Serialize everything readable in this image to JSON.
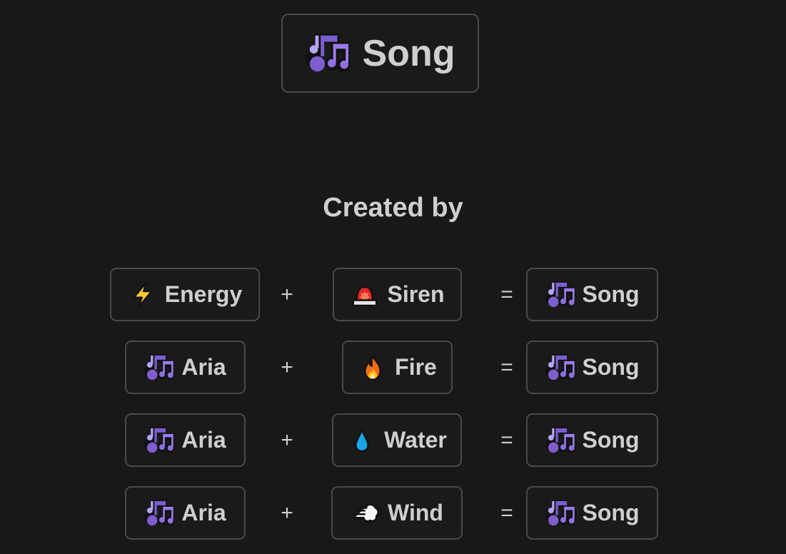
{
  "element": {
    "name": "Song",
    "icon": "musical-notes-icon"
  },
  "section_heading": "Created by",
  "recipes": [
    {
      "first": {
        "name": "Energy",
        "icon": "lightning-icon"
      },
      "plus": "+",
      "second": {
        "name": "Siren",
        "icon": "siren-light-icon"
      },
      "equals": "=",
      "result": {
        "name": "Song",
        "icon": "musical-notes-icon"
      }
    },
    {
      "first": {
        "name": "Aria",
        "icon": "musical-notes-icon"
      },
      "plus": "+",
      "second": {
        "name": "Fire",
        "icon": "fire-icon"
      },
      "equals": "=",
      "result": {
        "name": "Song",
        "icon": "musical-notes-icon"
      }
    },
    {
      "first": {
        "name": "Aria",
        "icon": "musical-notes-icon"
      },
      "plus": "+",
      "second": {
        "name": "Water",
        "icon": "water-drop-icon"
      },
      "equals": "=",
      "result": {
        "name": "Song",
        "icon": "musical-notes-icon"
      }
    },
    {
      "first": {
        "name": "Aria",
        "icon": "musical-notes-icon"
      },
      "plus": "+",
      "second": {
        "name": "Wind",
        "icon": "wind-icon"
      },
      "equals": "=",
      "result": {
        "name": "Song",
        "icon": "musical-notes-icon"
      }
    }
  ]
}
